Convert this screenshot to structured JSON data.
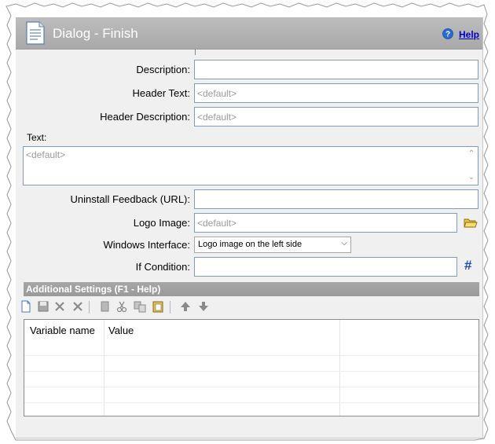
{
  "header": {
    "title": "Dialog - Finish",
    "help_label": "Help"
  },
  "form": {
    "description": {
      "label": "Description:",
      "value": "",
      "placeholder": ""
    },
    "header_text": {
      "label": "Header Text:",
      "value": "",
      "placeholder": "<default>"
    },
    "header_description": {
      "label": "Header Description:",
      "value": "",
      "placeholder": "<default>"
    },
    "text": {
      "label": "Text:",
      "value": "",
      "placeholder": "<default>"
    },
    "uninstall_feedback": {
      "label": "Uninstall Feedback (URL):",
      "value": "",
      "placeholder": ""
    },
    "logo_image": {
      "label": "Logo Image:",
      "value": "",
      "placeholder": "<default>",
      "browse_icon": "folder-open-icon"
    },
    "windows_interface": {
      "label": "Windows Interface:",
      "selected": "Logo image on the left side"
    },
    "if_condition": {
      "label": "If Condition:",
      "value": "",
      "placeholder": "",
      "action_icon": "hash-icon"
    }
  },
  "additional_settings": {
    "title": "Additional Settings (F1 - Help)",
    "toolbar": [
      "new-icon",
      "save-icon",
      "delete-icon",
      "delete-all-icon",
      "copy-icon",
      "cut-icon",
      "duplicate-icon",
      "paste-icon",
      "move-up-icon",
      "move-down-icon"
    ],
    "columns": [
      "Variable name",
      "Value"
    ]
  },
  "colors": {
    "header_bg": "#b0b0b0",
    "section_bg": "#a0a0a0",
    "link": "#0000cc",
    "input_border": "#7f9db9"
  }
}
